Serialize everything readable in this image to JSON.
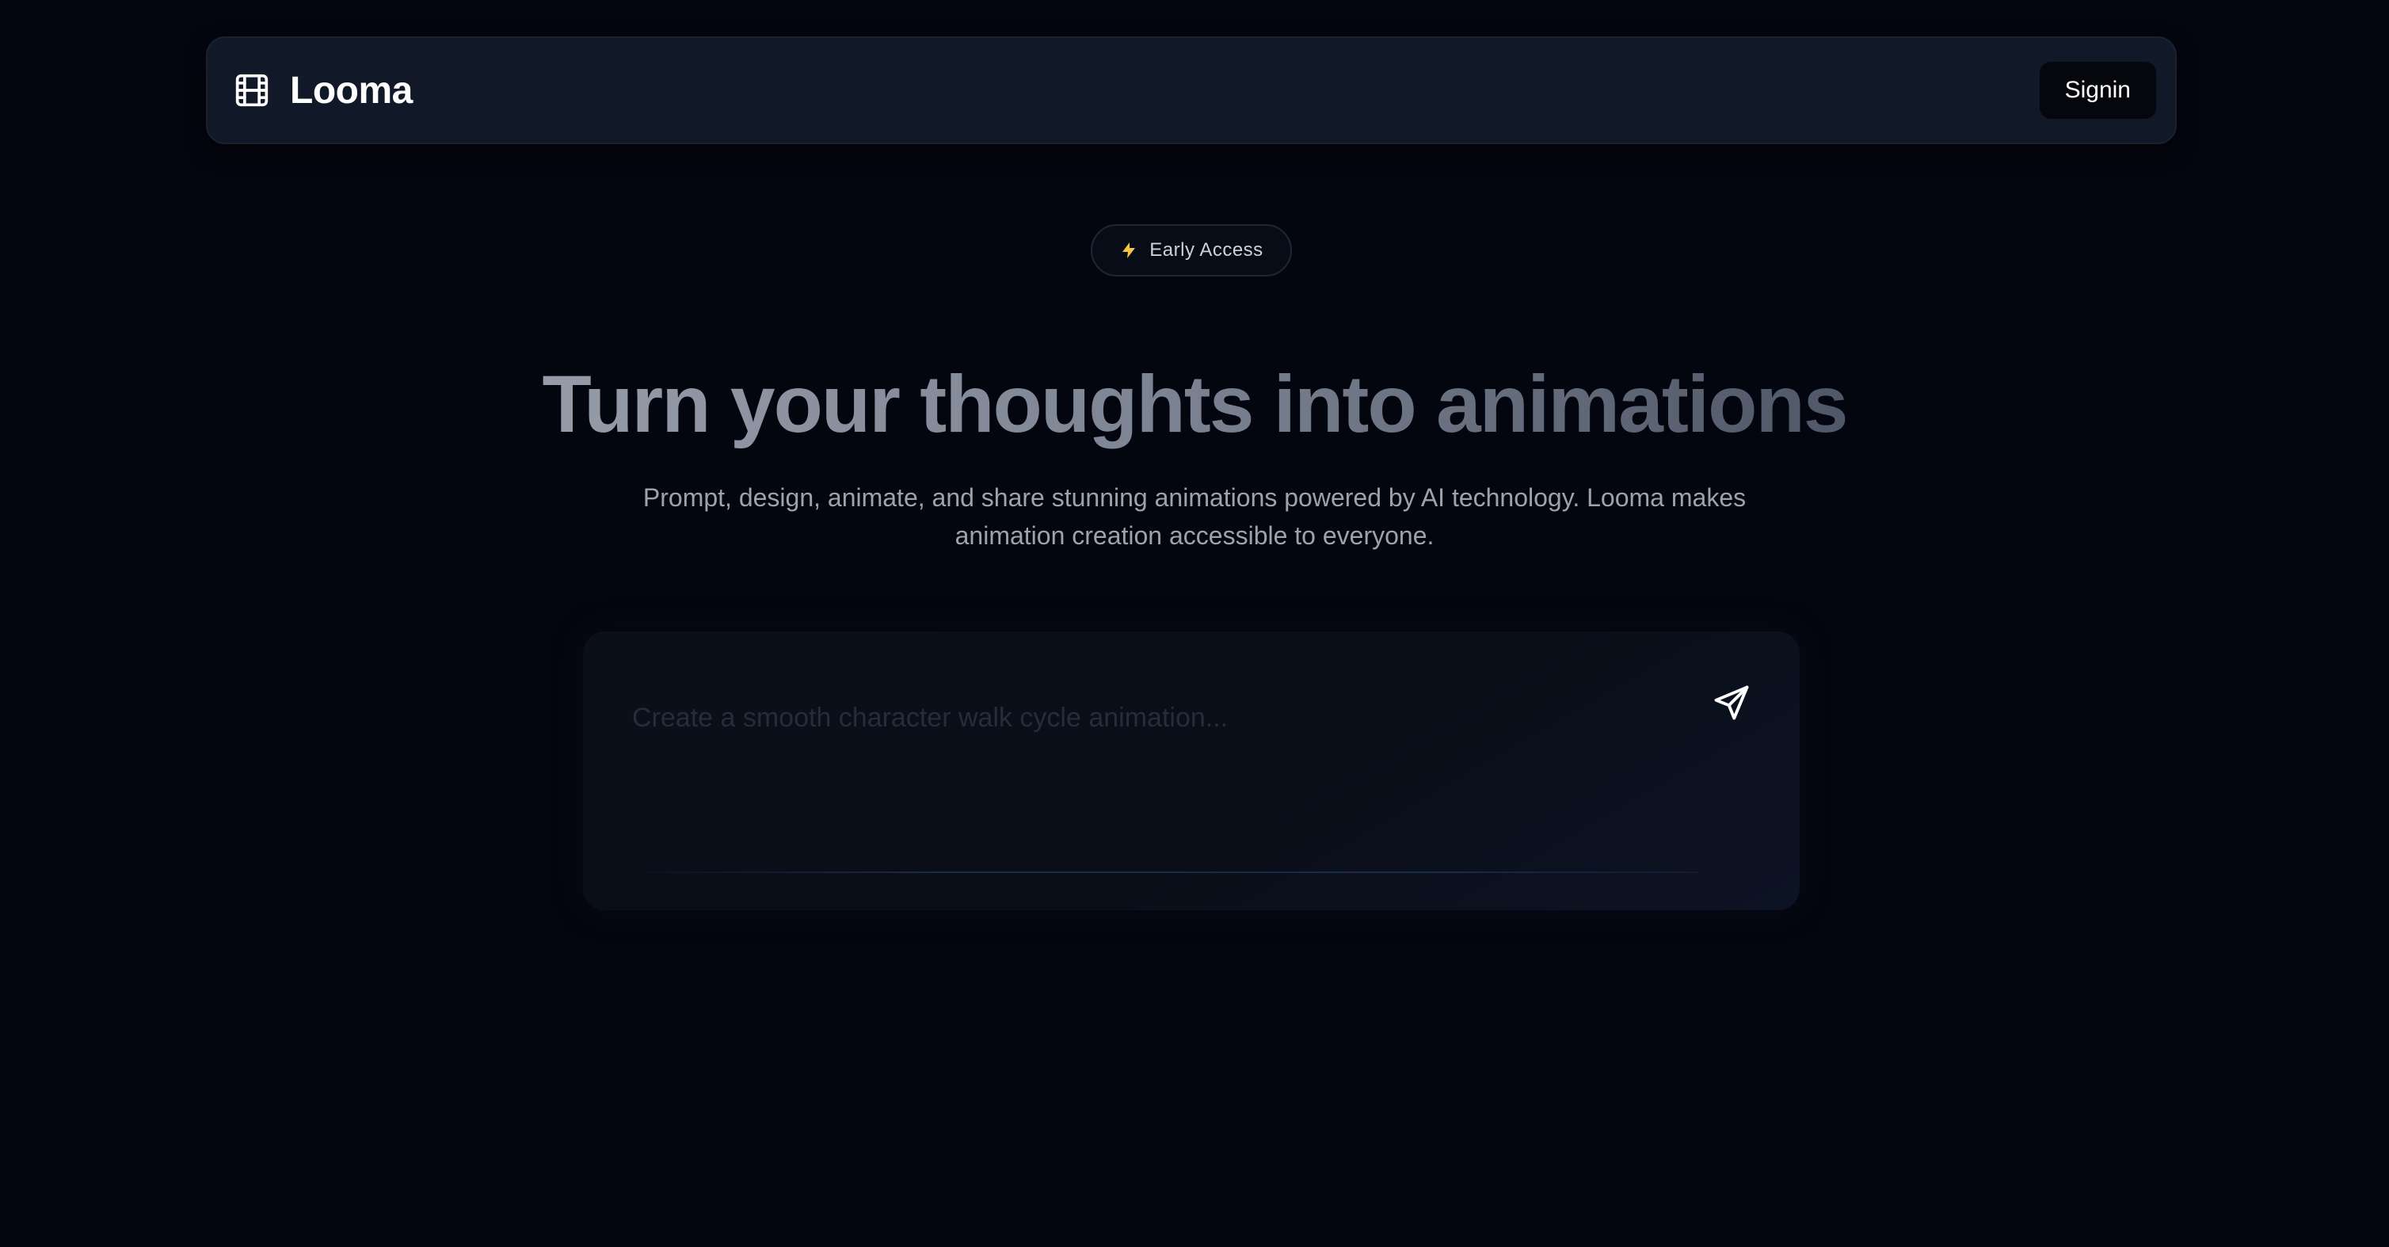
{
  "header": {
    "logo_icon": "film-icon",
    "brand_name": "Looma",
    "signin_label": "Signin"
  },
  "badge": {
    "icon": "lightning-bolt-icon",
    "label": "Early Access"
  },
  "hero": {
    "title": "Turn your thoughts into animations",
    "subtitle": "Prompt, design, animate, and share stunning animations powered by AI technology. Looma makes animation creation accessible to everyone."
  },
  "prompt": {
    "value": "",
    "placeholder": "Create a smooth character walk cycle animation...",
    "send_icon": "send-icon"
  },
  "colors": {
    "background": "#04060f",
    "navbar": "#111827",
    "bolt": "#f5c542",
    "title_gradient_start": "#969ba8",
    "title_gradient_end": "#4f5768"
  }
}
